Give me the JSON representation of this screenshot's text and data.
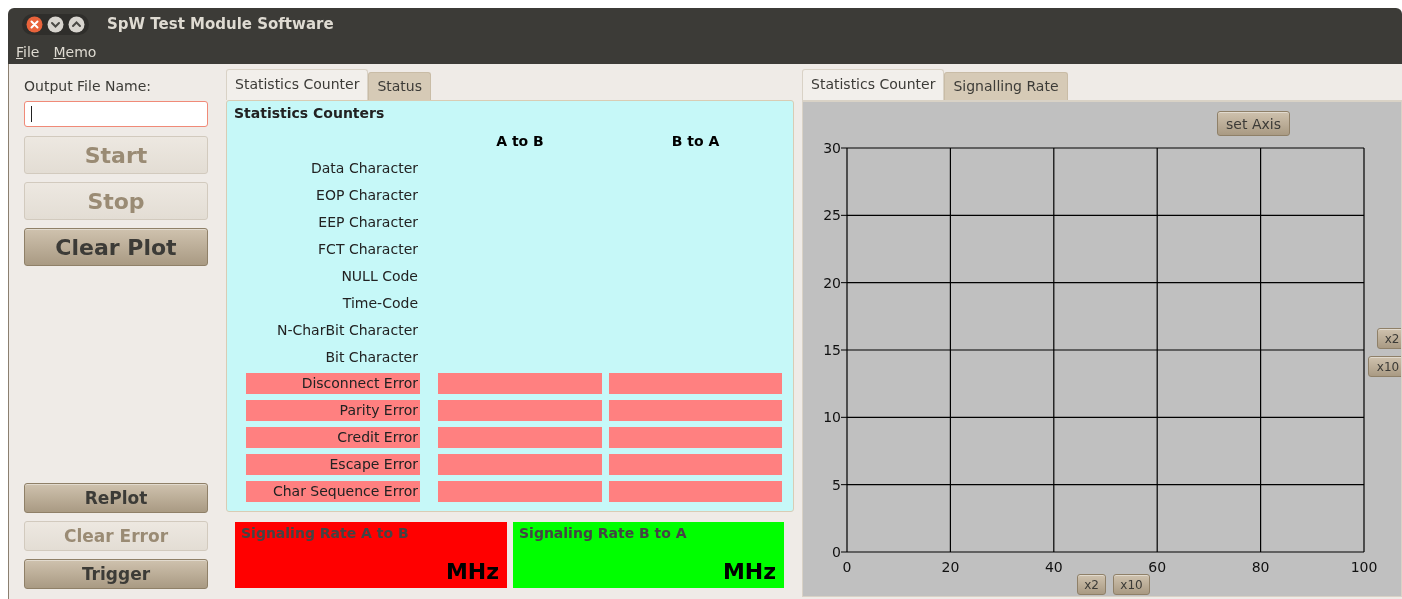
{
  "window": {
    "title": "SpW Test Module Software"
  },
  "menu": [
    "File",
    "Memo"
  ],
  "output_file": {
    "label": "Output File Name:",
    "focused": true
  },
  "top_buttons": [
    {
      "label": "Start",
      "disabled": true
    },
    {
      "label": "Stop",
      "disabled": true
    },
    {
      "label": "Clear Plot",
      "disabled": false
    }
  ],
  "bottom_buttons": [
    {
      "label": "RePlot",
      "disabled": false
    },
    {
      "label": "Clear Error",
      "disabled": true
    },
    {
      "label": "Trigger",
      "disabled": false
    }
  ],
  "stats_tabs": [
    {
      "label": "Statistics Counter",
      "selected": true
    },
    {
      "label": "Status",
      "selected": false
    }
  ],
  "stats": {
    "title": "Statistics Counters",
    "columns": [
      "A to B",
      "B to A"
    ],
    "rows": [
      {
        "label": "Data Character",
        "error": false
      },
      {
        "label": "EOP Character",
        "error": false
      },
      {
        "label": "EEP Character",
        "error": false
      },
      {
        "label": "FCT Character",
        "error": false
      },
      {
        "label": "NULL Code",
        "error": false
      },
      {
        "label": "Time-Code",
        "error": false
      },
      {
        "label": "N-CharBit Character",
        "error": false
      },
      {
        "label": "Bit Character",
        "error": false
      },
      {
        "label": "Disconnect Error",
        "error": true
      },
      {
        "label": "Parity Error",
        "error": true
      },
      {
        "label": "Credit Error",
        "error": true
      },
      {
        "label": "Escape Error",
        "error": true
      },
      {
        "label": "Char Sequence Error",
        "error": true
      }
    ]
  },
  "rates": [
    {
      "label": "Signaling Rate A to B",
      "unit": "MHz",
      "color": "#ff0000"
    },
    {
      "label": "Signaling Rate B to A",
      "unit": "MHz",
      "color": "#00ff00"
    }
  ],
  "plot_tabs": [
    {
      "label": "Statistics Counter",
      "selected": true
    },
    {
      "label": "Signalling Rate",
      "selected": false
    }
  ],
  "plot": {
    "set_axis_button": "set Axis",
    "y_zoom_buttons": [
      "x2",
      "x10"
    ],
    "x_zoom_buttons": [
      "x2",
      "x10"
    ],
    "chart_data": {
      "type": "line",
      "grid": true,
      "xlim": [
        0,
        100
      ],
      "ylim": [
        0,
        30
      ],
      "xticks": [
        0,
        20,
        40,
        60,
        80,
        100
      ],
      "yticks": [
        0,
        5,
        10,
        15,
        20,
        25,
        30
      ]
    }
  }
}
